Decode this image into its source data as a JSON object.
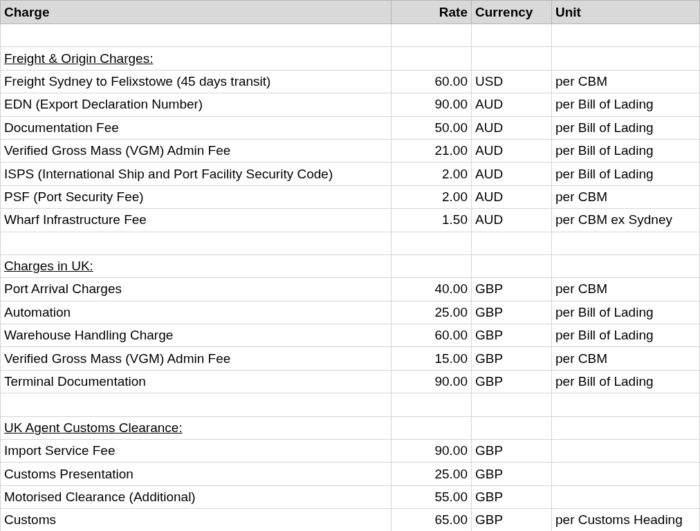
{
  "table": {
    "columns": [
      "Charge",
      "Rate",
      "Currency",
      "Unit"
    ],
    "rows": [
      {
        "kind": "blank"
      },
      {
        "kind": "section",
        "label": "Freight & Origin Charges:"
      },
      {
        "kind": "item",
        "charge": "Freight Sydney to Felixstowe (45 days transit)",
        "rate": "60.00",
        "currency": "USD",
        "unit": "per CBM"
      },
      {
        "kind": "item",
        "charge": "EDN (Export Declaration Number)",
        "rate": "90.00",
        "currency": "AUD",
        "unit": "per Bill of Lading"
      },
      {
        "kind": "item",
        "charge": "Documentation Fee",
        "rate": "50.00",
        "currency": "AUD",
        "unit": "per Bill of Lading"
      },
      {
        "kind": "item",
        "charge": "Verified Gross Mass (VGM) Admin Fee",
        "rate": "21.00",
        "currency": "AUD",
        "unit": "per Bill of Lading"
      },
      {
        "kind": "item",
        "charge": "ISPS (International Ship and Port Facility Security Code)",
        "rate": "2.00",
        "currency": "AUD",
        "unit": "per Bill of Lading"
      },
      {
        "kind": "item",
        "charge": "PSF (Port Security Fee)",
        "rate": "2.00",
        "currency": "AUD",
        "unit": "per CBM"
      },
      {
        "kind": "item",
        "charge": "Wharf Infrastructure Fee",
        "rate": "1.50",
        "currency": "AUD",
        "unit": "per CBM ex Sydney"
      },
      {
        "kind": "blank"
      },
      {
        "kind": "section",
        "label": "Charges in UK:"
      },
      {
        "kind": "item",
        "charge": "Port Arrival Charges",
        "rate": "40.00",
        "currency": "GBP",
        "unit": "per CBM"
      },
      {
        "kind": "item",
        "charge": "Automation",
        "rate": "25.00",
        "currency": "GBP",
        "unit": "per Bill of Lading"
      },
      {
        "kind": "item",
        "charge": "Warehouse Handling Charge",
        "rate": "60.00",
        "currency": "GBP",
        "unit": "per Bill of Lading"
      },
      {
        "kind": "item",
        "charge": "Verified Gross Mass (VGM) Admin Fee",
        "rate": "15.00",
        "currency": "GBP",
        "unit": "per CBM"
      },
      {
        "kind": "item",
        "charge": "Terminal Documentation",
        "rate": "90.00",
        "currency": "GBP",
        "unit": "per Bill of Lading"
      },
      {
        "kind": "blank"
      },
      {
        "kind": "section",
        "label": "UK Agent Customs Clearance:"
      },
      {
        "kind": "item",
        "charge": "Import Service Fee",
        "rate": "90.00",
        "currency": "GBP"
      },
      {
        "kind": "item",
        "charge": "Customs Presentation",
        "rate": "25.00",
        "currency": "GBP"
      },
      {
        "kind": "item",
        "charge": "Motorised Clearance (Additional)",
        "rate": "55.00",
        "currency": "GBP"
      },
      {
        "kind": "item",
        "charge": "Customs",
        "rate": "65.00",
        "currency": "GBP",
        "unit": "per Customs Heading"
      }
    ]
  }
}
